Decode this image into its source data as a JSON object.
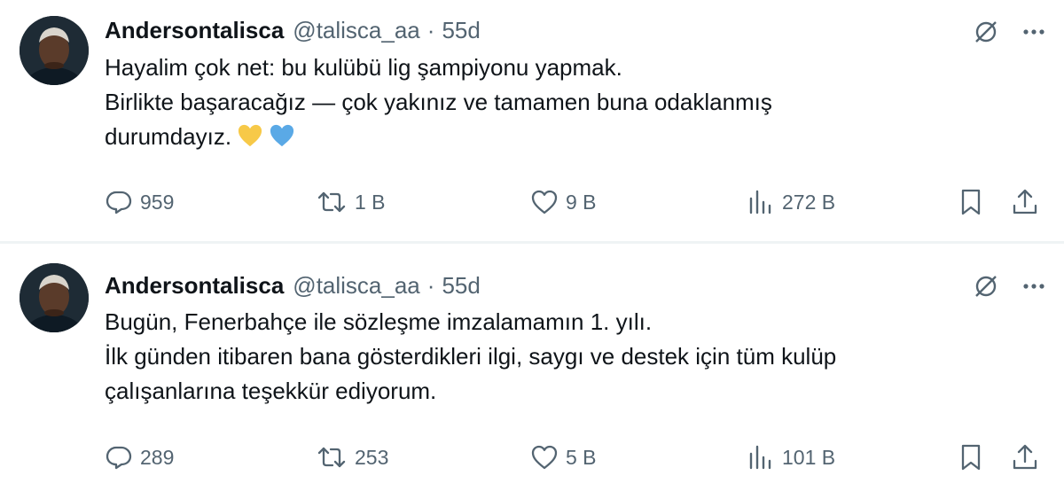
{
  "tweets": [
    {
      "author": {
        "name": "Andersontalisca",
        "handle": "@talisca_aa"
      },
      "separator": "·",
      "time": "55d",
      "text_lines": [
        "Hayalim çok net: bu kulübü lig şampiyonu yapmak.",
        "Birlikte başaracağız — çok yakınız ve tamamen buna odaklanmış",
        "durumdayız."
      ],
      "emojis": [
        "yellow-heart",
        "blue-heart"
      ],
      "stats": {
        "replies": "959",
        "reposts": "1 B",
        "likes": "9 B",
        "views": "272 B"
      }
    },
    {
      "author": {
        "name": "Andersontalisca",
        "handle": "@talisca_aa"
      },
      "separator": "·",
      "time": "55d",
      "text_lines": [
        "Bugün, Fenerbahçe ile sözleşme imzalamamın 1. yılı.",
        "İlk günden itibaren bana gösterdikleri ilgi, saygı ve destek için tüm kulüp",
        "çalışanlarına teşekkür ediyorum."
      ],
      "stats": {
        "replies": "289",
        "reposts": "253",
        "likes": "5 B",
        "views": "101 B"
      }
    }
  ],
  "colors": {
    "text": "#0f1419",
    "secondary": "#536471",
    "divider": "#eff3f4",
    "yellow_heart": "#f7c948",
    "blue_heart": "#5aa9e6"
  },
  "icons": [
    "grok-icon",
    "more-icon",
    "reply-icon",
    "repost-icon",
    "like-icon",
    "views-icon",
    "bookmark-icon",
    "share-icon"
  ]
}
